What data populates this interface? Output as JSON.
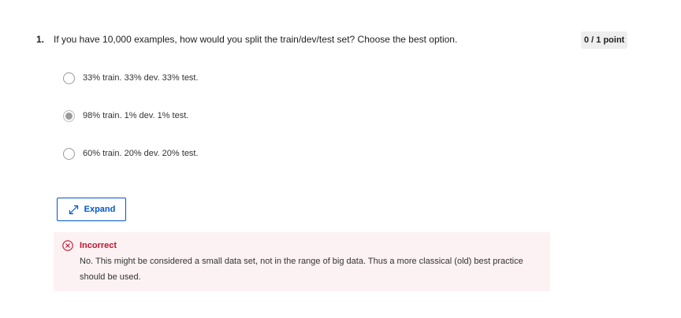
{
  "question": {
    "number": "1.",
    "text": "If you have 10,000 examples, how would you split the train/dev/test set? Choose the best option.",
    "points": "0 / 1 point"
  },
  "options": [
    {
      "label": "33% train. 33% dev. 33% test.",
      "selected": false
    },
    {
      "label": "98% train. 1% dev. 1% test.",
      "selected": true
    },
    {
      "label": "60% train. 20% dev. 20% test.",
      "selected": false
    }
  ],
  "expand": {
    "label": "Expand",
    "icon": "expand-arrows-icon"
  },
  "feedback": {
    "status": "Incorrect",
    "icon": "close-circle-icon",
    "message": "No. This might be considered a small data set, not in the range of big data. Thus a more classical (old) best practice should be used."
  },
  "colors": {
    "accent": "#0056d2",
    "error": "#c4122f",
    "feedback_bg": "#fdf2f3",
    "badge_bg": "#eeeeee"
  }
}
